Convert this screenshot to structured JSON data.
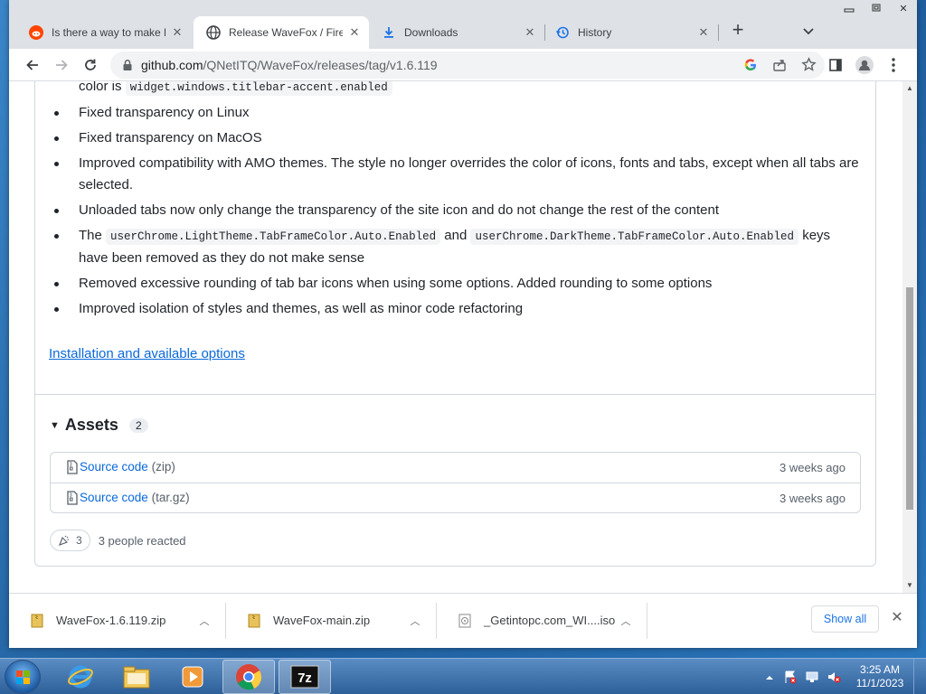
{
  "browser": {
    "tabs": [
      {
        "label": "Is there a way to make F",
        "icon": "reddit-icon",
        "active": false
      },
      {
        "label": "Release WaveFox / Firefo",
        "icon": "globe-icon",
        "active": true
      },
      {
        "label": "Downloads",
        "icon": "download-icon",
        "active": false
      },
      {
        "label": "History",
        "icon": "history-icon",
        "active": false
      }
    ],
    "url_host": "github.com",
    "url_path": "/QNetITQ/WaveFox/releases/tag/v1.6.119"
  },
  "release_notes": {
    "partial_line_prefix": "color is",
    "partial_line_code": "widget.windows.titlebar-accent.enabled",
    "items": [
      "Fixed transparency on Linux",
      "Fixed transparency on MacOS",
      "Improved compatibility with AMO themes. The style no longer overrides the color of icons, fonts and tabs, except when all tabs are selected.",
      "Unloaded tabs now only change the transparency of the site icon and do not change the rest of the content"
    ],
    "keys_item": {
      "pre": "The",
      "code1": "userChrome.LightTheme.TabFrameColor.Auto.Enabled",
      "mid": "and",
      "code2": "userChrome.DarkTheme.TabFrameColor.Auto.Enabled",
      "post": "keys have been removed as they do not make sense"
    },
    "items_after": [
      "Removed excessive rounding of tab bar icons when using some options. Added rounding to some options",
      "Improved isolation of styles and themes, as well as minor code refactoring"
    ]
  },
  "install_link": "Installation and available options",
  "assets": {
    "title": "Assets",
    "count": "2",
    "items": [
      {
        "name": "Source code",
        "type": "(zip)",
        "date": "3 weeks ago"
      },
      {
        "name": "Source code",
        "type": "(tar.gz)",
        "date": "3 weeks ago"
      }
    ]
  },
  "reactions": {
    "count": "3",
    "text": "3 people reacted"
  },
  "downloads": {
    "items": [
      {
        "name": "WaveFox-1.6.119.zip"
      },
      {
        "name": "WaveFox-main.zip"
      },
      {
        "name": "_Getintopc.com_WI....iso"
      }
    ],
    "show_all": "Show all"
  },
  "taskbar": {
    "time": "3:25 AM",
    "date": "11/1/2023"
  },
  "colors": {
    "link": "#0969da",
    "accent": "#1a73e8"
  }
}
